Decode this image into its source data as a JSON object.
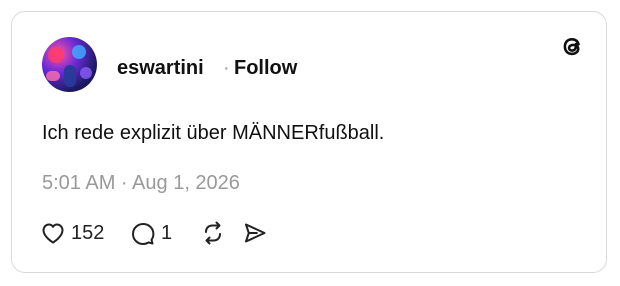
{
  "post": {
    "author": {
      "username": "eswartini",
      "separator": "·",
      "follow_label": "Follow"
    },
    "logo_icon": "threads-icon",
    "text": "Ich rede explizit über MÄNNERfußball.",
    "timestamp": "5:01 AM · Aug 1, 2026",
    "actions": {
      "like": {
        "icon": "heart-icon",
        "count": "152"
      },
      "reply": {
        "icon": "comment-icon",
        "count": "1"
      },
      "repost": {
        "icon": "repost-icon"
      },
      "share": {
        "icon": "send-icon"
      }
    }
  }
}
